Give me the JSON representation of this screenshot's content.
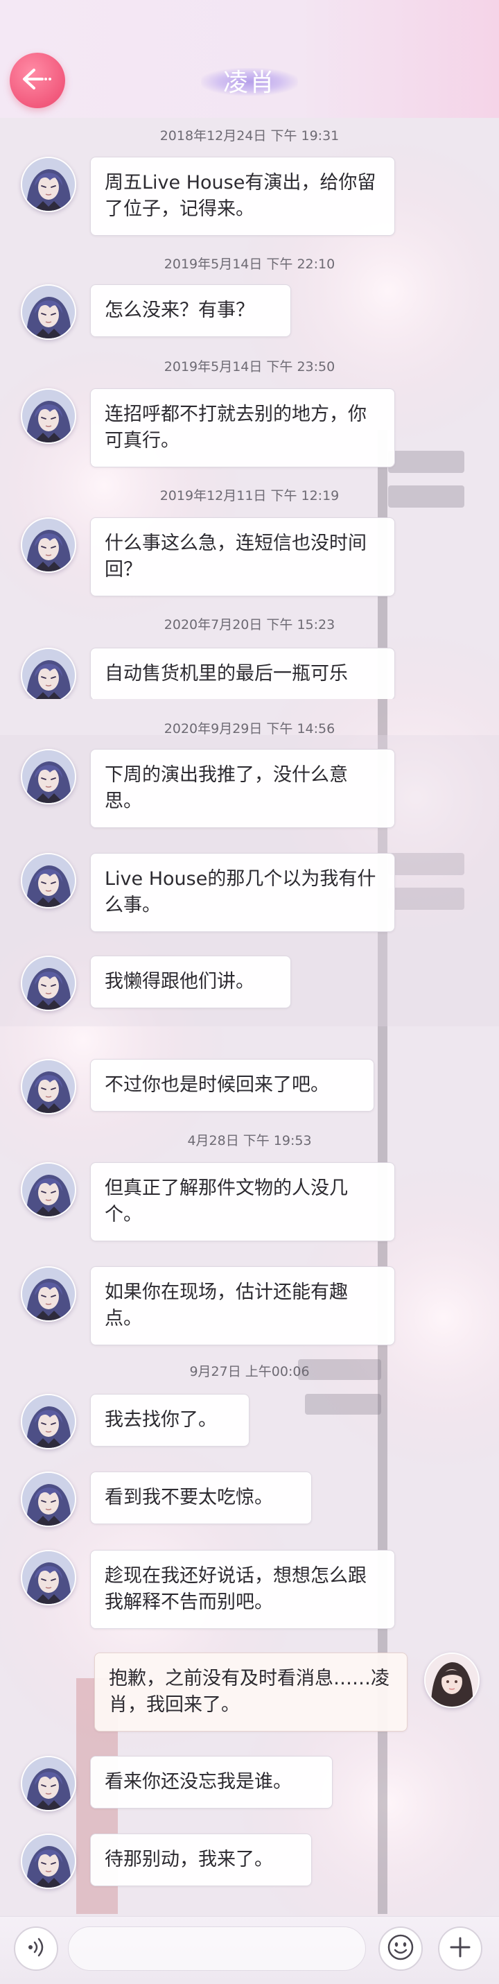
{
  "header": {
    "title": "凌肖"
  },
  "messages": [
    {
      "timestamp": "2018年12月24日 下午 19:31",
      "text": "周五Live House有演出，给你留了位子，记得来。"
    },
    {
      "timestamp": "2019年5月14日 下午 22:10",
      "text": "怎么没来？有事？"
    },
    {
      "timestamp": "2019年5月14日 下午 23:50",
      "text": "连招呼都不打就去别的地方，你可真行。"
    },
    {
      "timestamp": "2019年12月11日 下午 12:19",
      "text": "什么事这么急，连短信也没时间回？"
    },
    {
      "timestamp": "2020年7月20日 下午 15:23",
      "text": "自动售货机里的最后一瓶可乐"
    },
    {
      "timestamp": "2020年9月29日 下午 14:56",
      "text": "下周的演出我推了，没什么意思。"
    },
    {
      "text": "Live House的那几个以为我有什么事。"
    },
    {
      "text": "我懒得跟他们讲。"
    },
    {
      "text": "不过你也是时候回来了吧。"
    },
    {
      "timestamp": "4月28日 下午 19:53",
      "text": "但真正了解那件文物的人没几个。"
    },
    {
      "text": "如果你在现场，估计还能有趣点。"
    },
    {
      "timestamp": "9月27日 上午00:06",
      "text": "我去找你了。"
    },
    {
      "text": "看到我不要太吃惊。"
    },
    {
      "text": "趁现在我还好说话，想想怎么跟我解释不告而别吧。"
    },
    {
      "text": "抱歉，之前没有及时看消息……凌肖，我回来了。",
      "sender": "me"
    },
    {
      "text": "看来你还没忘我是谁。"
    },
    {
      "text": "待那别动，我来了。"
    }
  ],
  "icons": {
    "back": "arrow-left-icon",
    "voice": "voice-icon",
    "emoji": "emoji-icon",
    "plus": "plus-icon"
  },
  "colors": {
    "accent": "#f25a7d",
    "bubble": "#ffffff",
    "timestamp": "#6d6a73"
  }
}
